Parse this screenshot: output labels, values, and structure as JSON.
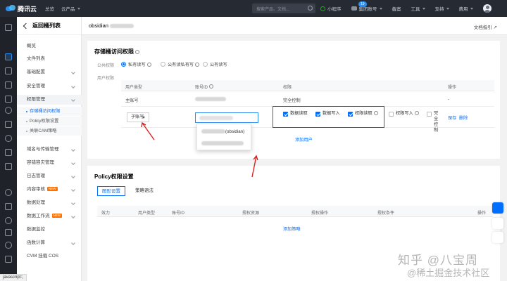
{
  "topbar": {
    "brand": "腾讯云",
    "nav_home": "总览",
    "nav_products": "云产品",
    "search_placeholder": "搜索产品、文档...",
    "mini_program": "小程序",
    "badge_count": "19",
    "group_account": "集团账号",
    "record": "备案",
    "tools": "工具",
    "support": "支持",
    "billing": "费用"
  },
  "sidebar": {
    "back_label": "返回桶列表",
    "items": [
      {
        "label": "概览"
      },
      {
        "label": "文件列表"
      },
      {
        "label": "基础配置"
      },
      {
        "label": "安全管理"
      },
      {
        "label": "权限管理"
      },
      {
        "label": "域名与传输管理"
      },
      {
        "label": "容错容灾管理"
      },
      {
        "label": "日志管理"
      },
      {
        "label": "内容审核",
        "tag": "NEW"
      },
      {
        "label": "数据处理"
      },
      {
        "label": "数据工作流",
        "tag": "NEW"
      },
      {
        "label": "数据监控"
      },
      {
        "label": "函数计算"
      },
      {
        "label": "CVM 挂载 COS"
      }
    ],
    "sub_items": [
      {
        "label": "存储桶访问权限"
      },
      {
        "label": "Policy权限设置"
      },
      {
        "label": "关联CAM策略"
      }
    ]
  },
  "main": {
    "bucket_name": "obsidian",
    "doc_guide": "文档指引",
    "acl": {
      "title": "存储桶访问权限",
      "public_label": "公共权限",
      "options": [
        "私有读写",
        "公有读私有写",
        "公有读写"
      ],
      "user_label": "用户权限",
      "columns": [
        "用户类型",
        "账号ID",
        "权限",
        "操作"
      ],
      "row1": {
        "type": "主账号",
        "permission": "完全控制",
        "op": "-"
      },
      "row2": {
        "type": "子账号",
        "input_placeholder": "请输入子账号ID",
        "dropdown_item": "(obsidian)",
        "checks": [
          "数据读取",
          "数据写入",
          "权限读取",
          "权限写入",
          "完全控制"
        ],
        "save": "保存",
        "delete": "删除"
      },
      "add_user": "添加用户"
    },
    "policy": {
      "title": "Policy权限设置",
      "tabs": [
        "图形设置",
        "策略语法"
      ],
      "columns": [
        "效力",
        "用户类型",
        "账号ID",
        "授权资源",
        "授权操作",
        "授权条件",
        "操作"
      ],
      "add_policy": "添加策略"
    }
  },
  "watermark": {
    "line1": "知乎 @八宝周",
    "line2": "@稀土掘金技术社区"
  },
  "statusbar": "javascript:;"
}
